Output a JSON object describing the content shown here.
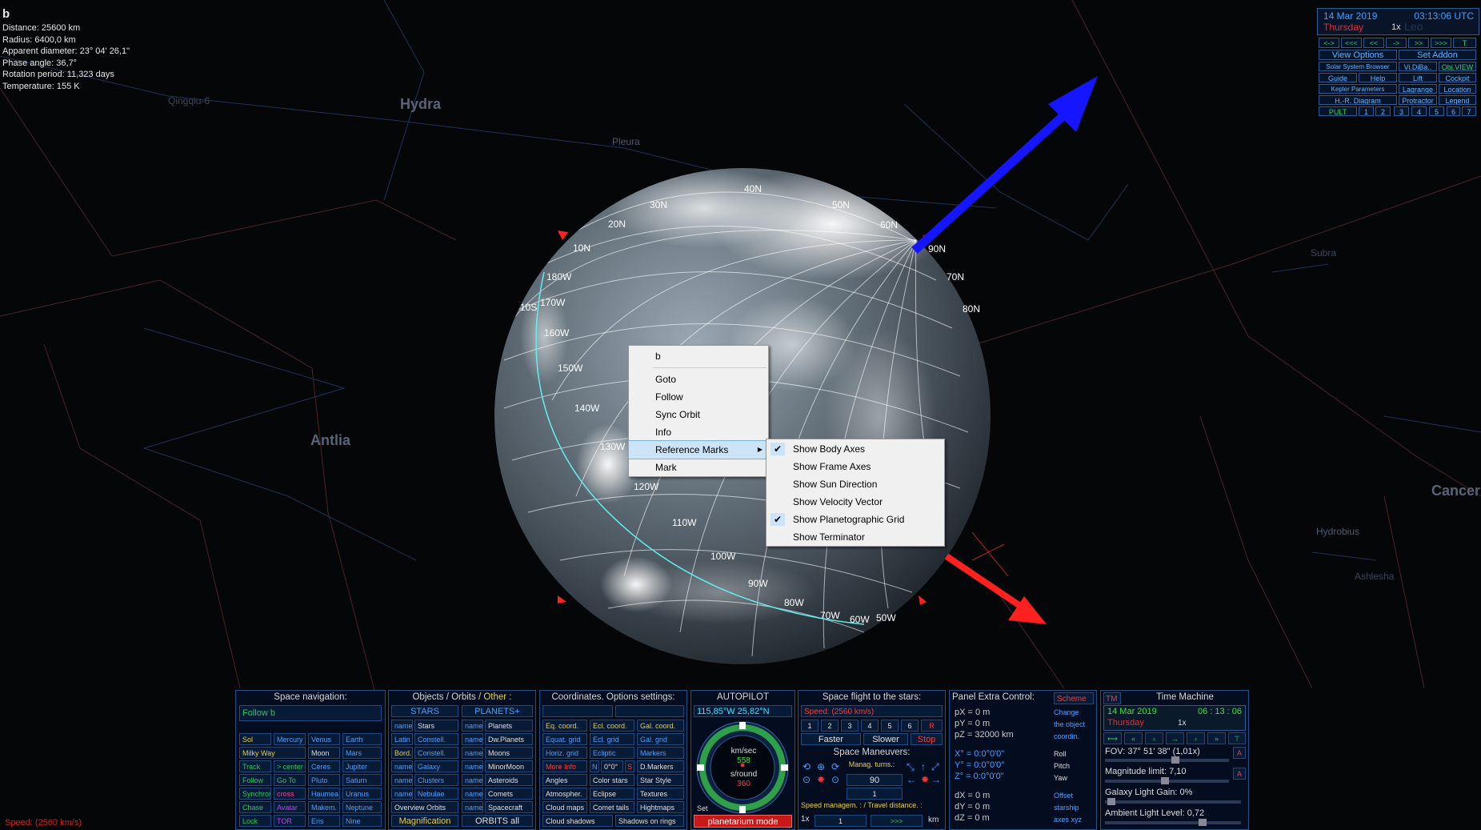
{
  "body_info": {
    "name": "b",
    "lines": [
      "Distance: 25600 km",
      "Radius: 6400,0 km",
      "Apparent diameter: 23° 04' 26,1\"",
      "Phase angle: 36,7°",
      "Rotation period: 11,323 days",
      "Temperature: 155 K"
    ]
  },
  "sky_labels": {
    "constellations": [
      "Hydra",
      "Antlia",
      "Cancer"
    ],
    "stars": [
      "Qingqiu-6",
      "Pleura",
      "Subra",
      "Hydrobius",
      "Ashlesha"
    ]
  },
  "grid_labels": [
    "30N",
    "20N",
    "10N",
    "40N",
    "50N",
    "60N",
    "70N",
    "80N",
    "90N",
    "180W",
    "170W",
    "160W",
    "150W",
    "140W",
    "130W",
    "120W",
    "110W",
    "100W",
    "90W",
    "80W",
    "70W",
    "60W",
    "50W",
    "10S"
  ],
  "context_menu": {
    "title": "b",
    "items": [
      "Goto",
      "Follow",
      "Sync Orbit",
      "Info"
    ],
    "submenu_item": "Reference Marks",
    "mark_item": "Mark"
  },
  "submenu": {
    "items": [
      {
        "label": "Show Body Axes",
        "checked": true
      },
      {
        "label": "Show Frame Axes",
        "checked": false
      },
      {
        "label": "Show Sun Direction",
        "checked": false
      },
      {
        "label": "Show Velocity Vector",
        "checked": false
      },
      {
        "label": "Show Planetographic Grid",
        "checked": true
      },
      {
        "label": "Show Terminator",
        "checked": false
      }
    ],
    "check_glyph": "✔"
  },
  "top_right": {
    "date": "14 Mar 2019",
    "time": "03:13:06 UTC",
    "weekday": "Thursday",
    "rate": "1x",
    "watermark": "Leo",
    "time_buttons": [
      "<->",
      "<<<",
      "<<",
      "->",
      ">>",
      ">>>",
      "T"
    ],
    "view_options": "View Options",
    "set_addon": "Set Addon",
    "rows": [
      [
        "Solar System Browser",
        "Vi.DiBa..",
        "Obj.VIEW"
      ],
      [
        "Guide",
        "Help",
        "Lift",
        "Cockpit"
      ],
      [
        "Kepler Parameters",
        "Lagrange",
        "Location"
      ],
      [
        "H.-R. Diagram",
        "Protractor",
        "Legend"
      ]
    ],
    "pult": "PULT",
    "pult_nums": [
      "1",
      "2",
      "3",
      "4",
      "5",
      "6",
      "7"
    ]
  },
  "space_nav": {
    "title": "Space navigation:",
    "follow": "Follow b",
    "grid": [
      [
        "Sol",
        "Mercury",
        "Venus",
        "Earth"
      ],
      [
        "Milky Way",
        "Moon",
        "Mars"
      ],
      [
        "Track",
        "> center",
        "Ceres",
        "Jupiter"
      ],
      [
        "Follow",
        "Go To",
        "Pluto",
        "Saturn"
      ],
      [
        "Synchron.",
        "cross",
        "Haumea",
        "Uranus"
      ],
      [
        "Chase",
        "Avatar",
        "Makem.",
        "Neptune"
      ],
      [
        "Lock",
        "TOR",
        "Eris",
        "Nine"
      ]
    ]
  },
  "objects": {
    "title_a": "Objects",
    "title_b": "/ Orbits",
    "title_c": "/ Other :",
    "stars_hdr": "STARS",
    "planets_hdr": "PLANETS+",
    "left": [
      [
        "name",
        "Stars"
      ],
      [
        "Latin",
        "Constell."
      ],
      [
        "Bord.",
        "Constell."
      ],
      [
        "name",
        "Galaxy"
      ],
      [
        "name",
        "Clusters"
      ],
      [
        "name",
        "Nebulae"
      ]
    ],
    "right": [
      [
        "name",
        "Planets"
      ],
      [
        "name",
        "Dw.Planets"
      ],
      [
        "name",
        "Moons"
      ],
      [
        "name",
        "MinorMoon"
      ],
      [
        "name",
        "Asteroids"
      ],
      [
        "name",
        "Comets"
      ],
      [
        "name",
        "Spacecraft"
      ]
    ],
    "overview": "Overview Orbits",
    "magnification": "Magnification",
    "orbits_all": "ORBITS all"
  },
  "coords": {
    "title": "Coordinates. Options settings:",
    "rows": [
      [
        "Eq. coord.",
        "Ecl. coord.",
        "Gal. coord."
      ],
      [
        "Equat. grid",
        "Ecl. grid",
        "Gal. grid"
      ],
      [
        "Horiz. grid",
        "Ecliptic",
        "Markers"
      ],
      [
        "More Info",
        "N",
        "0°0°",
        "S",
        "D.Markers"
      ],
      [
        "Angles",
        "Color stars",
        "Star Style"
      ],
      [
        "Atmospher.",
        "Eclipse",
        "Textures"
      ],
      [
        "Cloud maps",
        "Comet tails",
        "Hightmaps"
      ],
      [
        "Cloud shadows",
        "Shadows on rings"
      ]
    ]
  },
  "autopilot": {
    "title": "AUTOPILOT",
    "coords": "115,85°W  25,82°N",
    "unit1": "km/sec",
    "v1": "558",
    "unit2": "s/round",
    "v2": "360",
    "set": "Set",
    "mode": "planetarium mode"
  },
  "spaceflight": {
    "title": "Space flight to the stars:",
    "speed": "Speed: (2560 km/s)",
    "nums": [
      "1",
      "2",
      "3",
      "4",
      "5",
      "6",
      "R"
    ],
    "faster": "Faster",
    "slower": "Slower",
    "stop": "Stop",
    "maneuvers": "Space Maneuvers:",
    "manag": "Manag. turns.:",
    "turns": "90",
    "step": "1",
    "speed_mgmt": "Speed managem. : / Travel distance. :",
    "rate": "1x",
    "step2": "1",
    "go": ">>>",
    "km": "km"
  },
  "extra": {
    "title": "Panel Extra Control:",
    "scheme": "Scheme",
    "p": [
      "pX = 0 m",
      "pY = 0 m",
      "pZ = 32000 km"
    ],
    "change": [
      "Change",
      "the object",
      "coordin."
    ],
    "angles": [
      "X° = 0:0°0'0\"",
      "Y° = 0:0°0'0\"",
      "Z° = 0:0°0'0\""
    ],
    "rpy": [
      "Roll",
      "Pitch",
      "Yaw"
    ],
    "d": [
      "dX = 0 m",
      "dY = 0 m",
      "dZ = 0 m"
    ],
    "offset": [
      "Offset",
      "starship",
      "axes xyz"
    ]
  },
  "timemachine": {
    "tm": "TM",
    "title": "Time Machine",
    "date": "14 Mar 2019",
    "time": "06 : 13 : 06",
    "weekday": "Thursday",
    "rate": "1x",
    "fov": "FOV: 37° 51' 38\" (1,01x)",
    "mag": "Magnitude limit: 7,10",
    "galaxy": "Galaxy Light Gain: 0%",
    "ambient": "Ambient Light Level: 0,72"
  },
  "status": {
    "speed": "Speed: (2560 km/s)"
  },
  "colors": {
    "axis_blue": "#1515ff",
    "axis_red": "#ff2020",
    "grid": "#ffffff",
    "orbit": "#5ff0f0",
    "constellation_lines": "#1f3356",
    "border_lines": "#4a2020"
  }
}
